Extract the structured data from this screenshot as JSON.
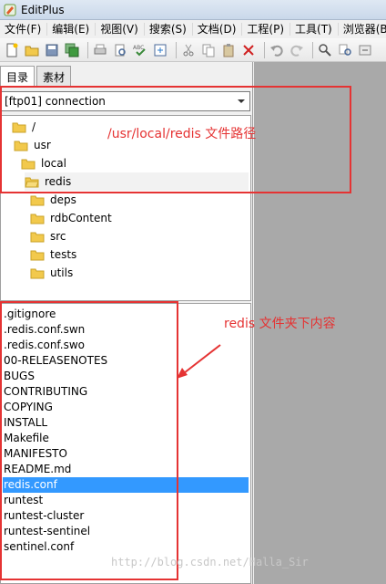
{
  "window": {
    "title": "EditPlus"
  },
  "menubar": [
    "文件(F)",
    "编辑(E)",
    "视图(V)",
    "搜索(S)",
    "文档(D)",
    "工程(P)",
    "工具(T)",
    "浏览器(B"
  ],
  "toolbar": {
    "icons": [
      "new-file-icon",
      "open-folder-icon",
      "save-icon",
      "save-all-icon",
      "print-icon",
      "print-preview-icon",
      "spellcheck-icon",
      "browser-preview-icon",
      "cut-icon",
      "copy-icon",
      "paste-icon",
      "delete-icon",
      "undo-icon",
      "redo-icon",
      "find-icon",
      "replace-icon",
      "more-icon"
    ]
  },
  "sidebar": {
    "tabs": [
      "目录",
      "素材"
    ],
    "active_tab": "目录",
    "connection": "[ftp01] connection",
    "tree": [
      {
        "label": "/",
        "depth": 0
      },
      {
        "label": "usr",
        "depth": 1
      },
      {
        "label": "local",
        "depth": 2
      },
      {
        "label": "redis",
        "depth": 3,
        "selected": true
      },
      {
        "label": "deps",
        "depth": 4
      },
      {
        "label": "rdbContent",
        "depth": 4
      },
      {
        "label": "src",
        "depth": 4
      },
      {
        "label": "tests",
        "depth": 4
      },
      {
        "label": "utils",
        "depth": 4
      }
    ],
    "files": [
      ".gitignore",
      ".redis.conf.swn",
      ".redis.conf.swo",
      "00-RELEASENOTES",
      "BUGS",
      "CONTRIBUTING",
      "COPYING",
      "INSTALL",
      "Makefile",
      "MANIFESTO",
      "README.md",
      "redis.conf",
      "runtest",
      "runtest-cluster",
      "runtest-sentinel",
      "sentinel.conf"
    ],
    "selected_file": "redis.conf"
  },
  "annotations": {
    "path_note": "/usr/local/redis  文件路径",
    "content_note": "redis 文件夹下内容"
  },
  "watermark": "http://blog.csdn.net/Halla_Sir",
  "colors": {
    "annotation": "#e53333",
    "selection": "#3399ff",
    "folder": "#f2c94c"
  }
}
